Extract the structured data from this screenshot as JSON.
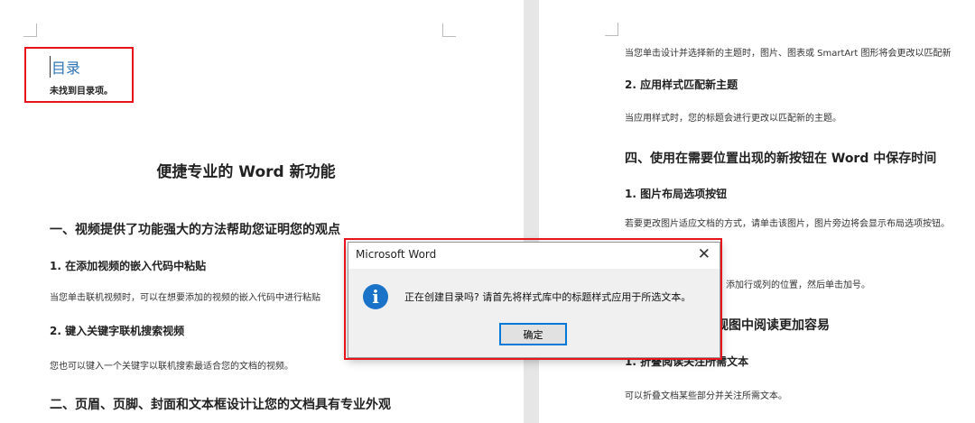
{
  "left_page": {
    "toc_heading": "目录",
    "toc_empty": "未找到目录项。",
    "title": "便捷专业的 Word 新功能",
    "sec1": "一、视频提供了功能强大的方法帮助您证明您的观点",
    "sec1_1": "1.  在添加视频的嵌入代码中粘贴",
    "sec1_1_body": "当您单击联机视频时，可以在想要添加的视频的嵌入代码中进行粘贴",
    "sec1_2": "2. 键入关键字联机搜索视频",
    "sec1_2_body": "您也可以键入一个关键字以联机搜索最适合您的文档的视频。",
    "sec2": "二、页眉、页脚、封面和文本框设计让您的文档具有专业外观"
  },
  "right_page": {
    "line1": "当您单击设计并选择新的主题时，图片、图表或 SmartArt 图形将会更改以匹配新",
    "h_2": "2. 应用样式匹配新主题",
    "body_2": "当应用样式时，您的标题会进行更改以匹配新的主题。",
    "sec4": "四、使用在需要位置出现的新按钮在 Word 中保存时间",
    "h_4_1": "1.  图片布局选项按钮",
    "body_4_1": "若要更改图片适应文档的方式，请单击该图片，图片旁边将会显示布局选项按钮。",
    "partial_body": "添加行或列的位置，然后单击加号。",
    "partial_sec": "视图中阅读更加容易",
    "h_5_1": "1.  折叠阅读关注所需文本",
    "body_5_1": "可以折叠文档某些部分并关注所需文本。"
  },
  "dialog": {
    "title": "Microsoft Word",
    "message": "正在创建目录吗? 请首先将样式库中的标题样式应用于所选文本。",
    "ok_label": "确定",
    "icon": "info-icon"
  },
  "colors": {
    "highlight": "#e8141b",
    "toc_heading": "#2e74b5",
    "info": "#1a73c8"
  }
}
